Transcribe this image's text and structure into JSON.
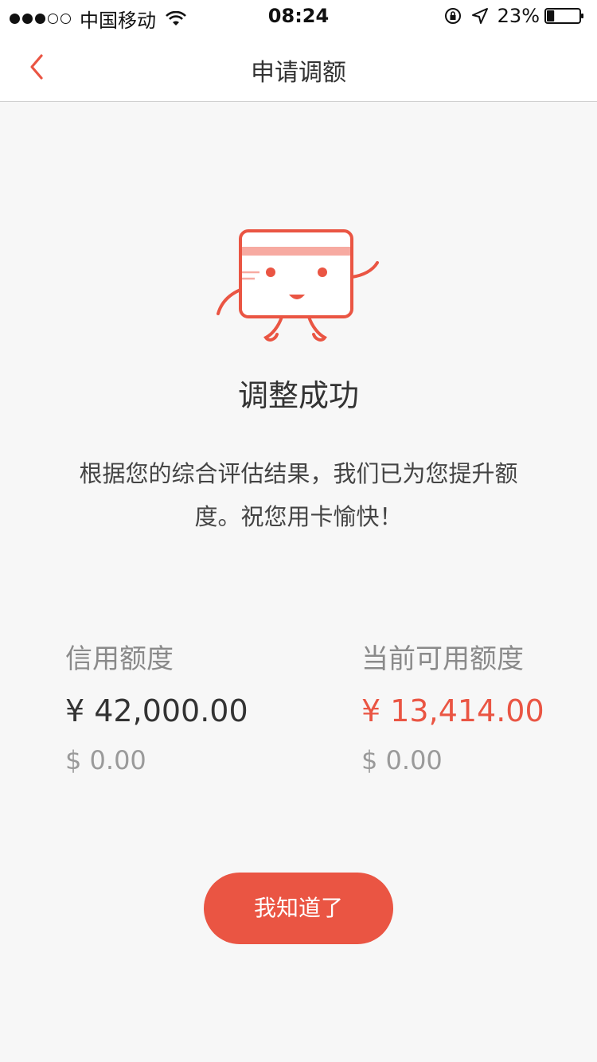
{
  "status_bar": {
    "carrier": "中国移动",
    "time": "08:24",
    "battery": "23%",
    "battery_level": 0.23,
    "signal_bars": 3,
    "signal_total": 5
  },
  "nav": {
    "title": "申请调额",
    "back_icon": "chevron-left-icon"
  },
  "result": {
    "title": "调整成功",
    "description": "根据您的综合评估结果，我们已为您提升额度。祝您用卡愉快！"
  },
  "limits": {
    "credit": {
      "label": "信用额度",
      "cny": "¥ 42,000.00",
      "usd": "$ 0.00"
    },
    "available": {
      "label": "当前可用额度",
      "cny": "¥ 13,414.00",
      "usd": "$ 0.00"
    }
  },
  "button": {
    "label": "我知道了"
  },
  "colors": {
    "accent": "#ea5543",
    "background": "#f7f7f7"
  }
}
